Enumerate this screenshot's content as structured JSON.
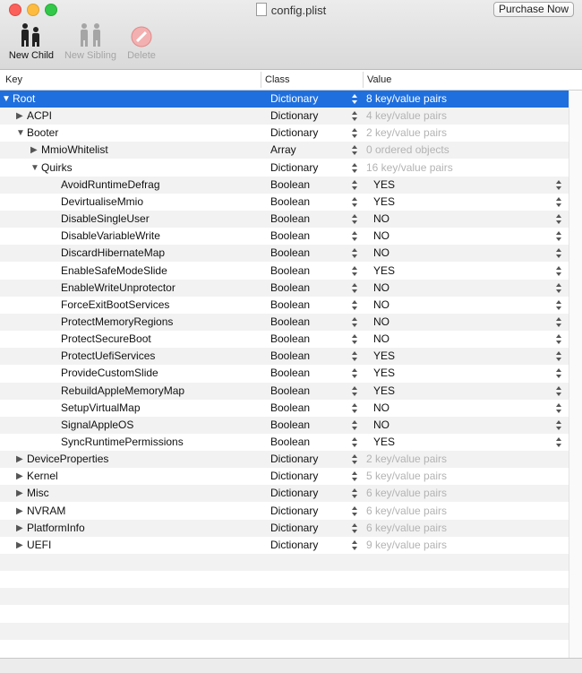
{
  "window": {
    "title": "config.plist",
    "purchase_label": "Purchase Now"
  },
  "toolbar": {
    "new_child": "New Child",
    "new_sibling": "New Sibling",
    "delete": "Delete"
  },
  "columns": {
    "key": "Key",
    "class": "Class",
    "value": "Value"
  },
  "rows": [
    {
      "key": "Root",
      "class": "Dictionary",
      "value": "8 key/value pairs",
      "level": 0,
      "expander": "open",
      "selected": true
    },
    {
      "key": "ACPI",
      "class": "Dictionary",
      "value": "4 key/value pairs",
      "level": 1,
      "expander": "closed"
    },
    {
      "key": "Booter",
      "class": "Dictionary",
      "value": "2 key/value pairs",
      "level": 1,
      "expander": "open"
    },
    {
      "key": "MmioWhitelist",
      "class": "Array",
      "value": "0 ordered objects",
      "level": 2,
      "expander": "closed"
    },
    {
      "key": "Quirks",
      "class": "Dictionary",
      "value": "16 key/value pairs",
      "level": 2,
      "expander": "open"
    },
    {
      "key": "AvoidRuntimeDefrag",
      "class": "Boolean",
      "value": "YES",
      "level": 3
    },
    {
      "key": "DevirtualiseMmio",
      "class": "Boolean",
      "value": "YES",
      "level": 3
    },
    {
      "key": "DisableSingleUser",
      "class": "Boolean",
      "value": "NO",
      "level": 3
    },
    {
      "key": "DisableVariableWrite",
      "class": "Boolean",
      "value": "NO",
      "level": 3
    },
    {
      "key": "DiscardHibernateMap",
      "class": "Boolean",
      "value": "NO",
      "level": 3
    },
    {
      "key": "EnableSafeModeSlide",
      "class": "Boolean",
      "value": "YES",
      "level": 3
    },
    {
      "key": "EnableWriteUnprotector",
      "class": "Boolean",
      "value": "NO",
      "level": 3
    },
    {
      "key": "ForceExitBootServices",
      "class": "Boolean",
      "value": "NO",
      "level": 3
    },
    {
      "key": "ProtectMemoryRegions",
      "class": "Boolean",
      "value": "NO",
      "level": 3
    },
    {
      "key": "ProtectSecureBoot",
      "class": "Boolean",
      "value": "NO",
      "level": 3
    },
    {
      "key": "ProtectUefiServices",
      "class": "Boolean",
      "value": "YES",
      "level": 3
    },
    {
      "key": "ProvideCustomSlide",
      "class": "Boolean",
      "value": "YES",
      "level": 3
    },
    {
      "key": "RebuildAppleMemoryMap",
      "class": "Boolean",
      "value": "YES",
      "level": 3
    },
    {
      "key": "SetupVirtualMap",
      "class": "Boolean",
      "value": "NO",
      "level": 3
    },
    {
      "key": "SignalAppleOS",
      "class": "Boolean",
      "value": "NO",
      "level": 3
    },
    {
      "key": "SyncRuntimePermissions",
      "class": "Boolean",
      "value": "YES",
      "level": 3
    },
    {
      "key": "DeviceProperties",
      "class": "Dictionary",
      "value": "2 key/value pairs",
      "level": 1,
      "expander": "closed"
    },
    {
      "key": "Kernel",
      "class": "Dictionary",
      "value": "5 key/value pairs",
      "level": 1,
      "expander": "closed"
    },
    {
      "key": "Misc",
      "class": "Dictionary",
      "value": "6 key/value pairs",
      "level": 1,
      "expander": "closed"
    },
    {
      "key": "NVRAM",
      "class": "Dictionary",
      "value": "6 key/value pairs",
      "level": 1,
      "expander": "closed"
    },
    {
      "key": "PlatformInfo",
      "class": "Dictionary",
      "value": "6 key/value pairs",
      "level": 1,
      "expander": "closed"
    },
    {
      "key": "UEFI",
      "class": "Dictionary",
      "value": "9 key/value pairs",
      "level": 1,
      "expander": "closed"
    }
  ],
  "colors": {
    "selection": "#1f6fde",
    "dim_text": "#b3b3b3",
    "close": "#fc605b",
    "minimize": "#fdbc40",
    "maximize": "#34c84a"
  }
}
